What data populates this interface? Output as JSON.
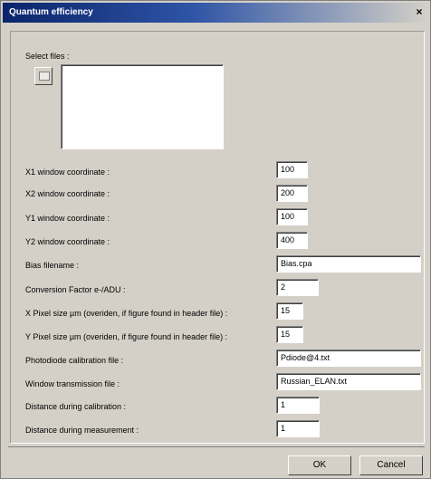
{
  "window": {
    "title": "Quantum efficiency",
    "close_label": "×"
  },
  "select_files": {
    "label": "Select files :"
  },
  "fields": [
    {
      "label": "X1 window coordinate :",
      "value": "100"
    },
    {
      "label": "X2 window coordinate :",
      "value": "200"
    },
    {
      "label": "Y1 window coordinate :",
      "value": "100"
    },
    {
      "label": "Y2 window coordinate :",
      "value": "400"
    },
    {
      "label": "Bias filename :",
      "value": "Bias.cpa"
    },
    {
      "label": "Conversion Factor e-/ADU :",
      "value": "2"
    },
    {
      "label": "X Pixel size µm (overiden, if figure found in header file) :",
      "value": "15"
    },
    {
      "label": "Y Pixel size µm (overiden, if figure found in header file) :",
      "value": "15"
    },
    {
      "label": "Photodiode calibration file :",
      "value": "Pdiode@4.txt"
    },
    {
      "label": "Window transmission file :",
      "value": "Russian_ELAN.txt"
    },
    {
      "label": "Distance during calibration :",
      "value": "1"
    },
    {
      "label": "Distance during measurement :",
      "value": "1"
    }
  ],
  "buttons": {
    "ok": "OK",
    "cancel": "Cancel"
  }
}
